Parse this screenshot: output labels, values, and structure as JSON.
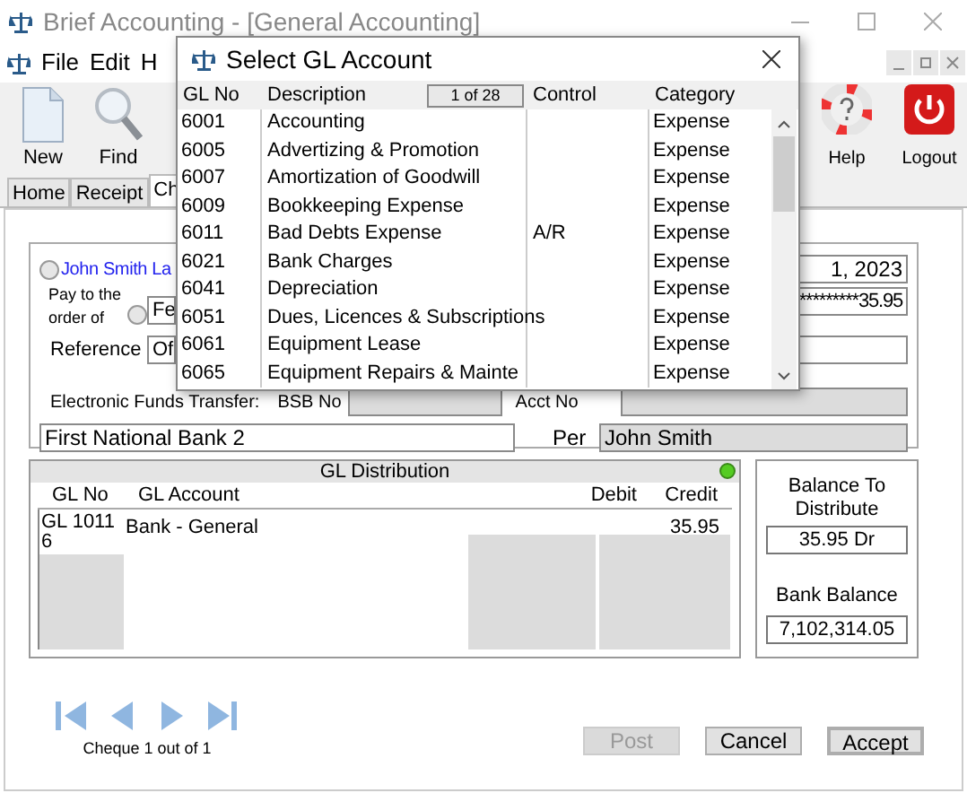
{
  "window": {
    "title": "Brief Accounting - [General Accounting]"
  },
  "menu": [
    "File",
    "Edit",
    "H"
  ],
  "toolbar_left": [
    {
      "kind": "new",
      "label": "New"
    },
    {
      "kind": "find",
      "label": "Find"
    }
  ],
  "toolbar_right": [
    {
      "kind": "help",
      "label": "Help"
    },
    {
      "kind": "logout",
      "label": "Logout"
    }
  ],
  "tabs": [
    {
      "label": "Home",
      "selected": false
    },
    {
      "label": "Receipt",
      "selected": false
    },
    {
      "label": "Ch",
      "selected": true
    }
  ],
  "cheque": {
    "payee_option": {
      "label": "John Smith La",
      "selected": false
    },
    "date": "1, 2023",
    "pay_to_label": "Pay to the order of",
    "pay_to_option_selected": false,
    "pay_to_value": "Fe",
    "amount": "*********35.95",
    "reference_label": "Reference",
    "reference_value": "Of",
    "eft_label": "Electronic Funds Transfer:",
    "bsb_label": "BSB No",
    "acct_label": "Acct No",
    "bank": "First National Bank 2",
    "per_label": "Per",
    "per_value": "John Smith"
  },
  "gl_distribution": {
    "title": "GL Distribution",
    "columns": [
      "GL No",
      "GL Account",
      "Debit",
      "Credit"
    ],
    "rows": [
      {
        "gl_no": "GL 10116",
        "account": "Bank - General",
        "credit": "35.95"
      }
    ]
  },
  "balance_to_distribute": {
    "label": "Balance To Distribute",
    "value": "35.95 Dr"
  },
  "bank_balance": {
    "label": "Bank Balance",
    "value": "7,102,314.05"
  },
  "navigator": {
    "caption": "Cheque 1 out of 1"
  },
  "buttons": [
    {
      "label": "Post",
      "disabled": true,
      "default": false
    },
    {
      "label": "Cancel",
      "disabled": false,
      "default": false
    },
    {
      "label": "Accept",
      "disabled": false,
      "default": true
    }
  ],
  "dialog": {
    "title": "Select GL Account",
    "columns": [
      "GL No",
      "Description",
      "Control",
      "Category"
    ],
    "page": "1 of 28",
    "rows": [
      {
        "gl_no": "6001",
        "description": "Accounting",
        "control": "",
        "category": "Expense"
      },
      {
        "gl_no": "6005",
        "description": "Advertizing & Promotion",
        "control": "",
        "category": "Expense"
      },
      {
        "gl_no": "6007",
        "description": "Amortization of Goodwill",
        "control": "",
        "category": "Expense"
      },
      {
        "gl_no": "6009",
        "description": "Bookkeeping Expense",
        "control": "",
        "category": "Expense"
      },
      {
        "gl_no": "6011",
        "description": "Bad Debts Expense",
        "control": "A/R",
        "category": "Expense"
      },
      {
        "gl_no": "6021",
        "description": "Bank Charges",
        "control": "",
        "category": "Expense"
      },
      {
        "gl_no": "6041",
        "description": "Depreciation",
        "control": "",
        "category": "Expense"
      },
      {
        "gl_no": "6051",
        "description": "Dues, Licences & Subscriptions",
        "control": "",
        "category": "Expense"
      },
      {
        "gl_no": "6061",
        "description": "Equipment Lease",
        "control": "",
        "category": "Expense"
      },
      {
        "gl_no": "6065",
        "description": "Equipment Repairs & Mainte",
        "control": "",
        "category": "Expense"
      }
    ]
  }
}
